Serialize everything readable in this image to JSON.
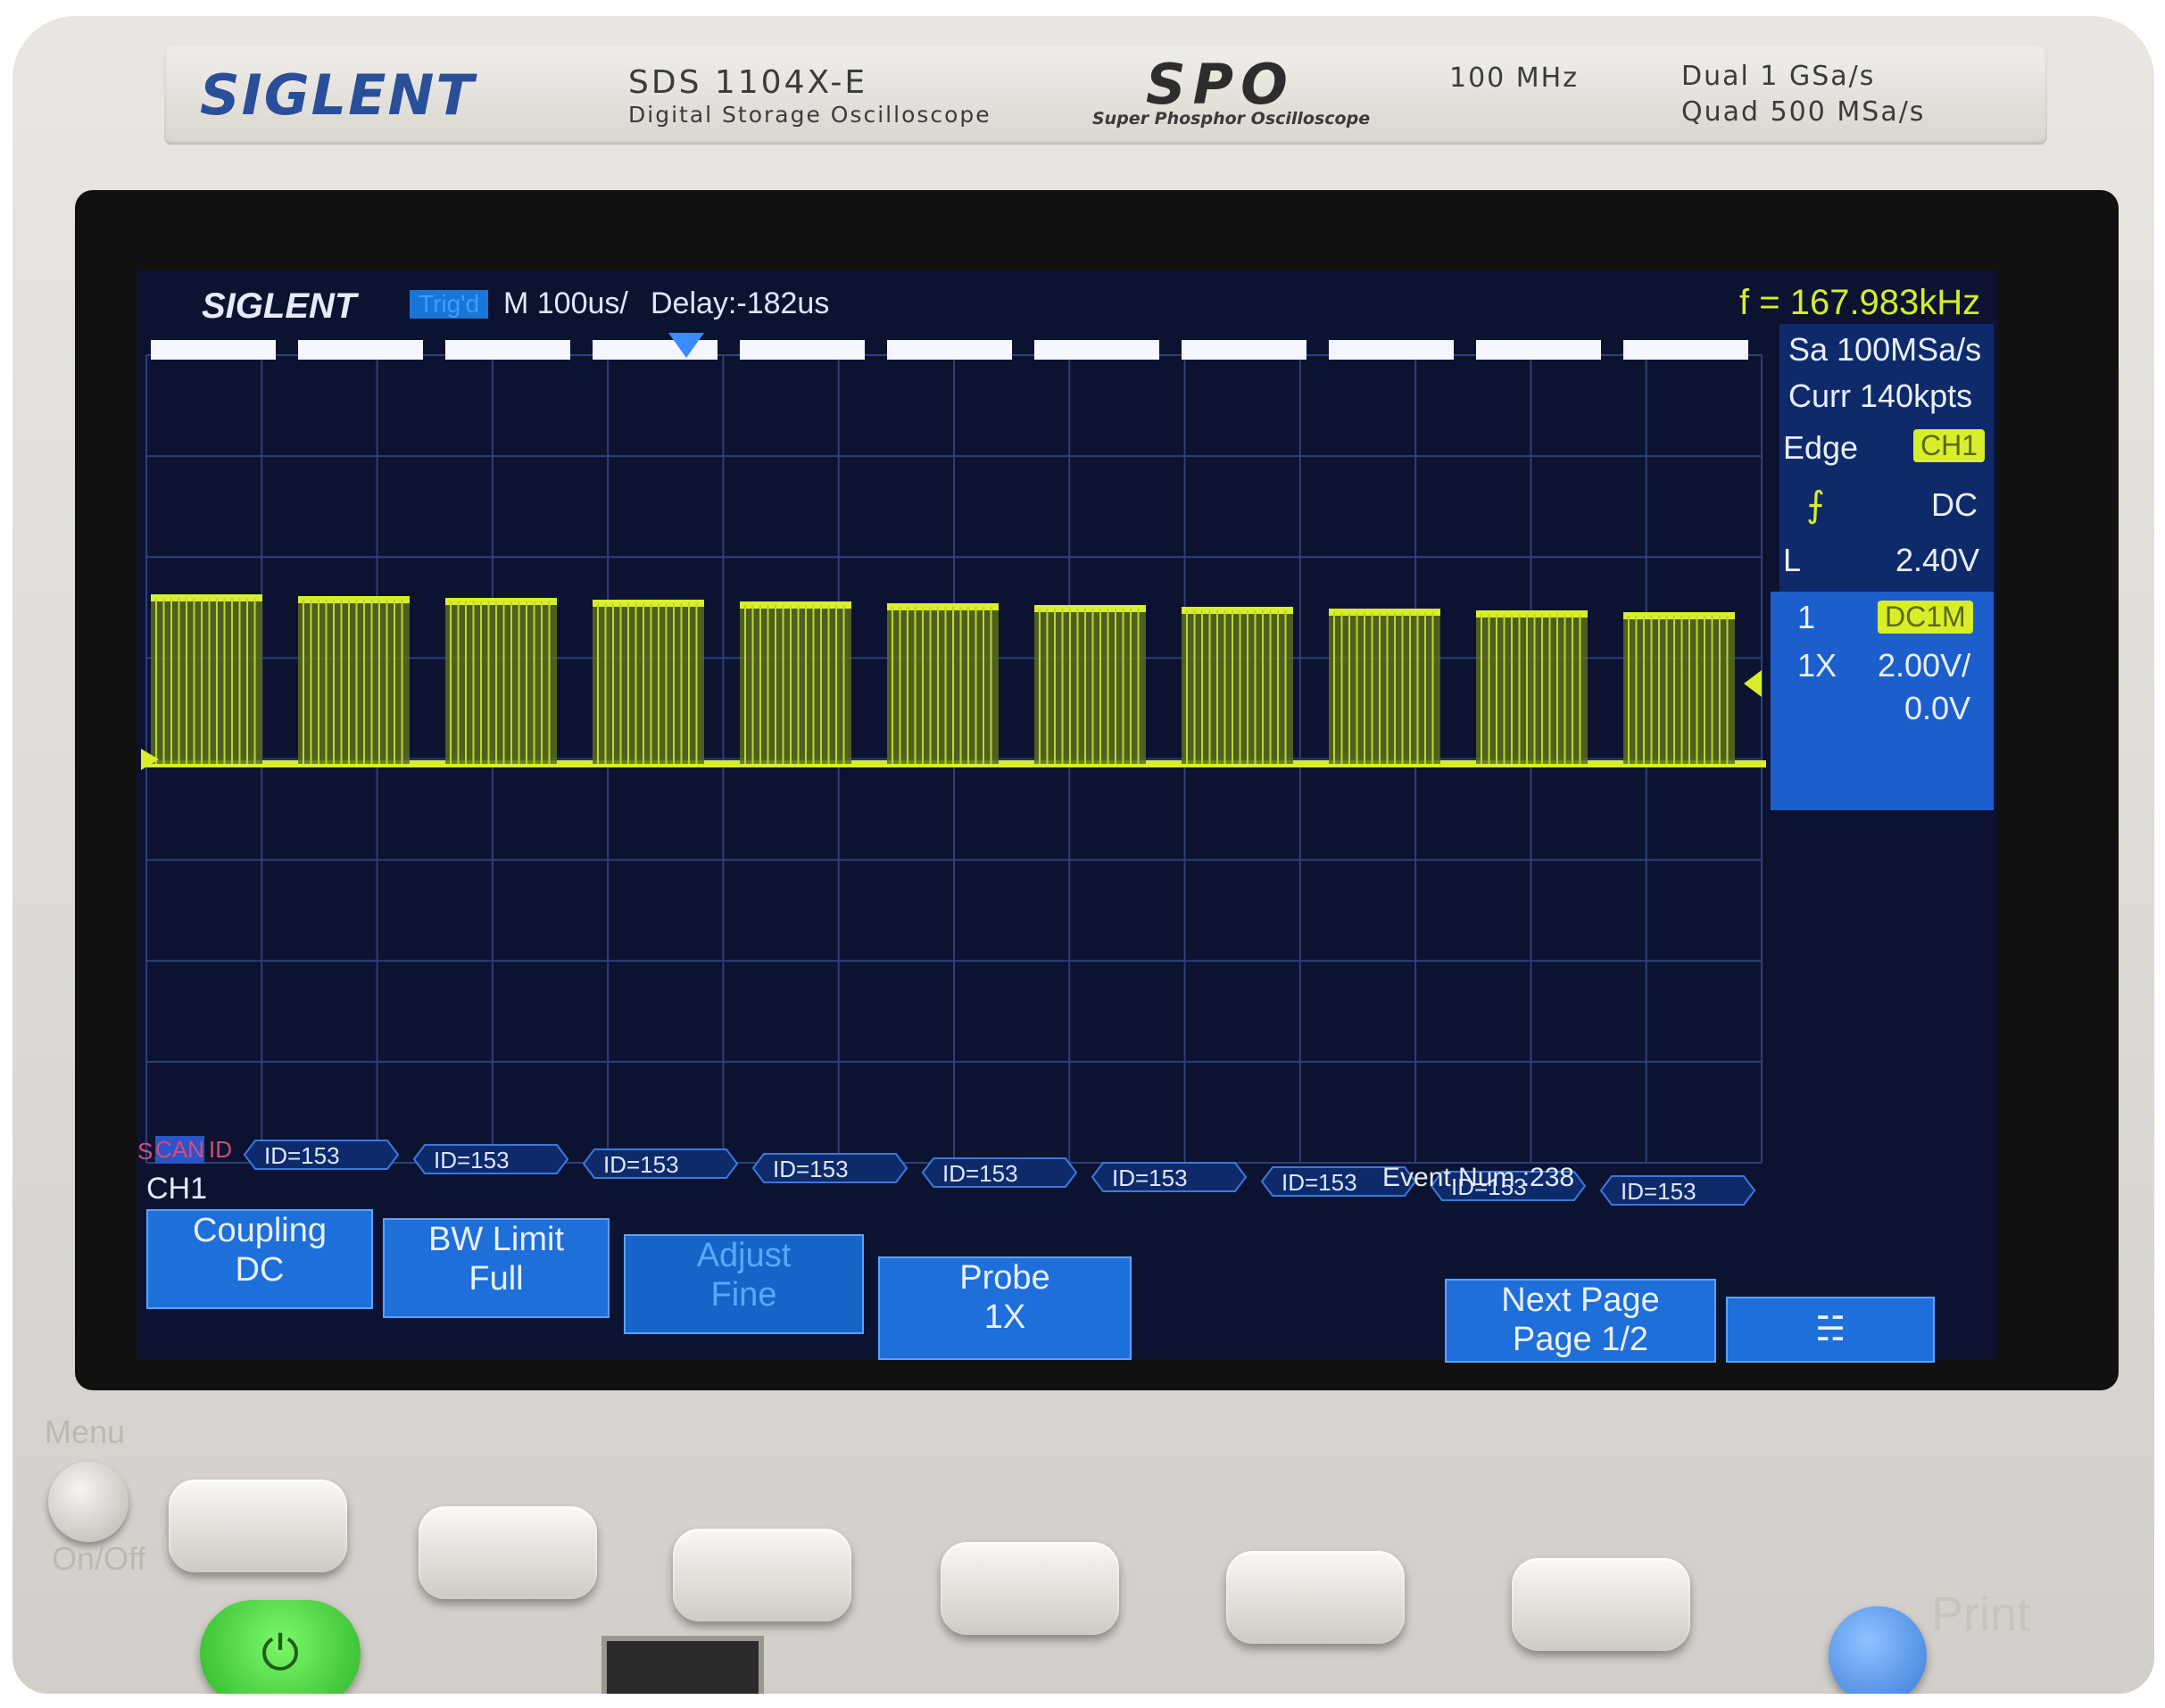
{
  "device": {
    "brand": "SIGLENT",
    "model": "SDS 1104X-E",
    "model_subtitle": "Digital Storage Oscilloscope",
    "spo_logo": "SPO",
    "spo_subtitle": "Super Phosphor Oscilloscope",
    "bandwidth": "100 MHz",
    "sample_rate_dual": "Dual  1 GSa/s",
    "sample_rate_quad": "Quad  500 MSa/s"
  },
  "screen": {
    "logo": "SIGLENT",
    "trigger_status": "Trig'd",
    "timebase": "M 100us/",
    "delay": "Delay:-182us",
    "frequency": "f = 167.983kHz",
    "sample_rate": "Sa 100MSa/s",
    "memory": "Curr 140kpts",
    "trigger": {
      "type": "Edge",
      "source": "CH1",
      "coupling": "DC",
      "level_label": "L",
      "level": "2.40V"
    },
    "channel": {
      "number": "1",
      "impedance": "DC1M",
      "probe": "1X",
      "scale": "2.00V/",
      "offset": "0.0V"
    },
    "decode": {
      "bus_label": "S1",
      "protocol": "CAN",
      "field": "ID",
      "frame_label": "ID=153",
      "frame_count_visible": 9,
      "event_text": "Event Num :238"
    },
    "menu_title": "CH1",
    "softkeys": [
      {
        "line1": "Coupling",
        "line2": "DC"
      },
      {
        "line1": "BW Limit",
        "line2": "Full"
      },
      {
        "line1": "Adjust",
        "line2": "Fine"
      },
      {
        "line1": "Probe",
        "line2": "1X"
      },
      {
        "line1": "Next Page",
        "line2": "Page 1/2"
      }
    ],
    "network_icon": "network-icon",
    "colors": {
      "trace": "#d8ee2a",
      "background": "#0c1330",
      "panel": "#0f2a6a",
      "softkey": "#1e6fd9"
    }
  },
  "front_panel": {
    "menu_label": "Menu",
    "onoff_label": "On/Off",
    "print_label": "Print",
    "power_icon": "power-icon"
  }
}
